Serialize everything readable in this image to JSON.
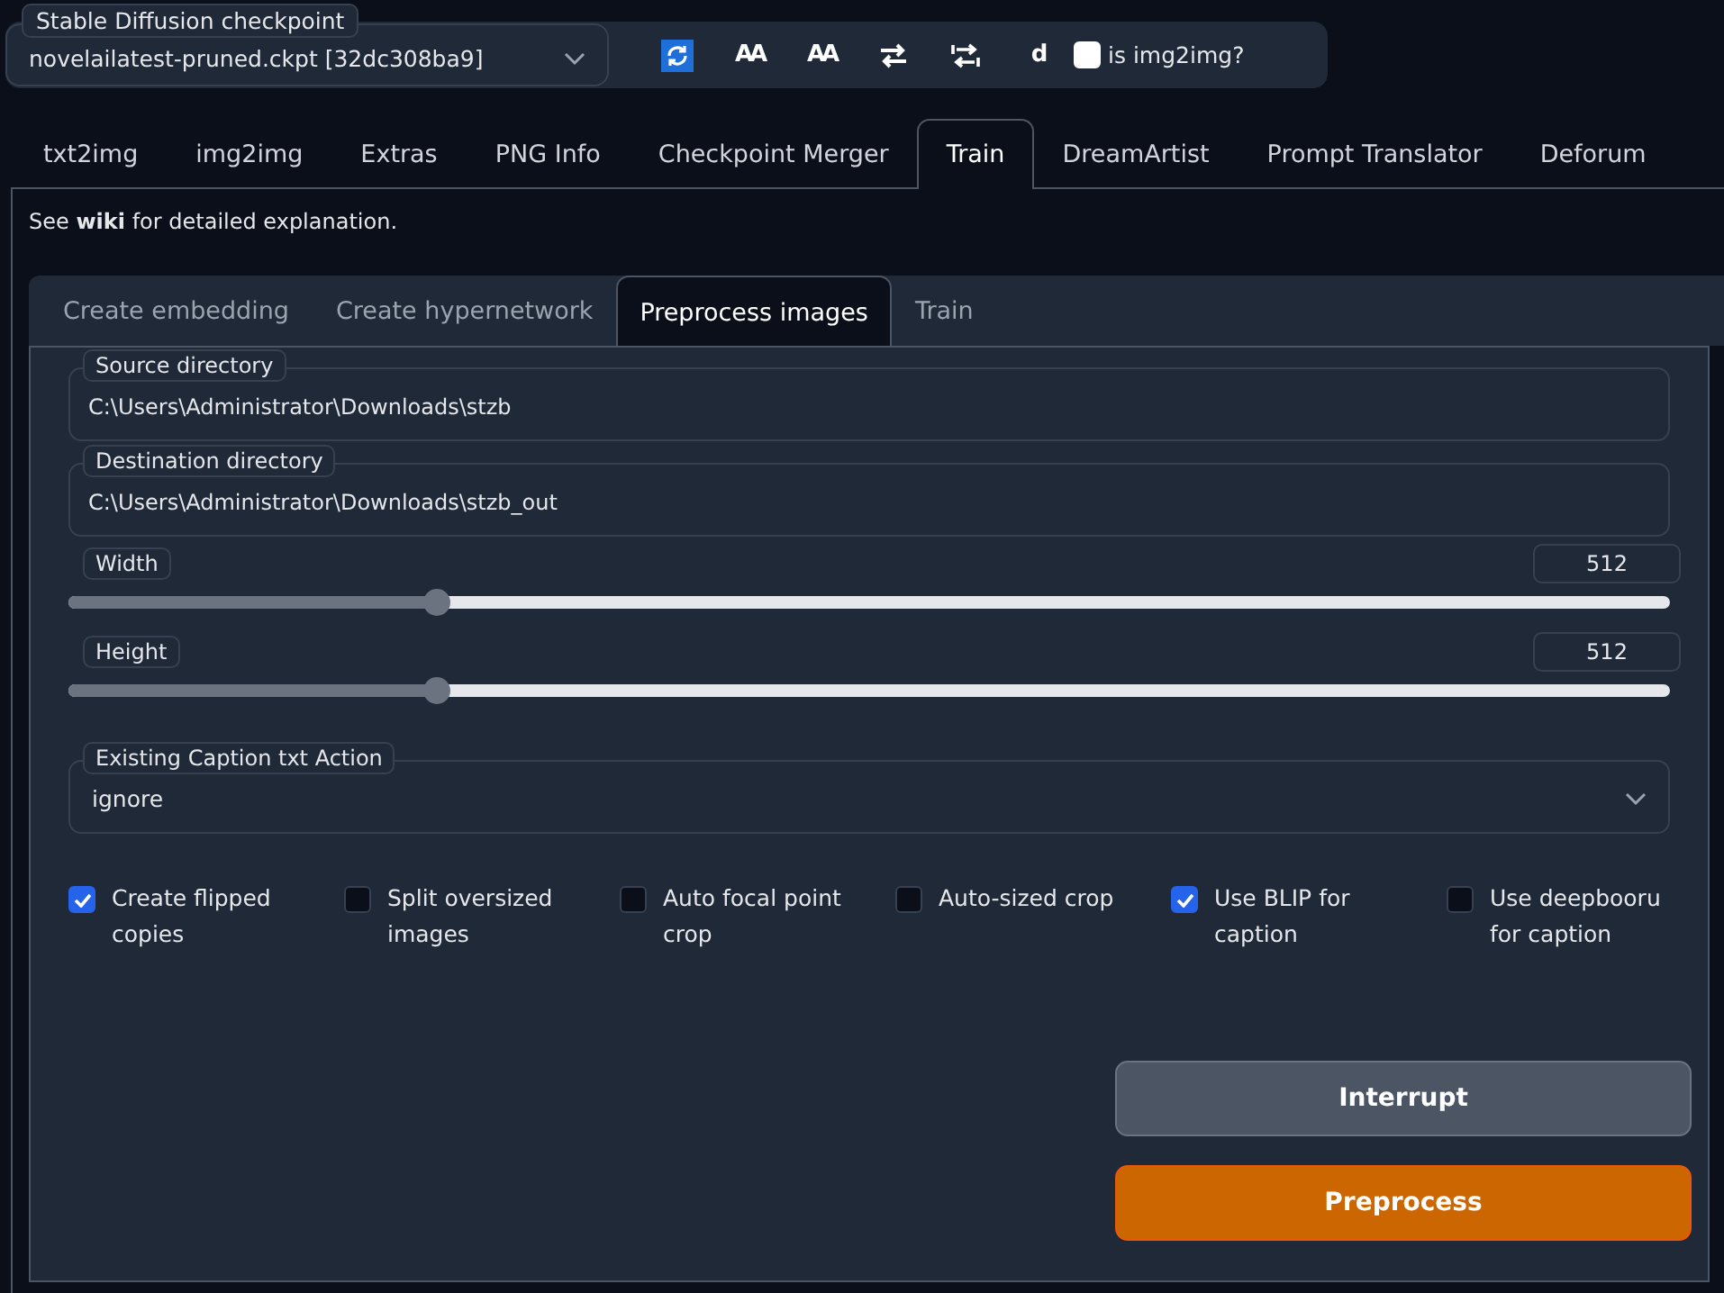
{
  "checkpoint": {
    "label": "Stable Diffusion checkpoint",
    "value": "novelailatest-pruned.ckpt [32dc308ba9]"
  },
  "toolbar": [
    {
      "kind": "refresh"
    },
    {
      "kind": "text",
      "label": "AA"
    },
    {
      "kind": "text",
      "label": "AA"
    },
    {
      "kind": "swap"
    },
    {
      "kind": "tabswap"
    },
    {
      "kind": "text",
      "label": "d"
    }
  ],
  "img2img_checkbox": {
    "label": "is img2img?",
    "checked": false
  },
  "tabs": [
    {
      "label": "txt2img",
      "selected": false
    },
    {
      "label": "img2img",
      "selected": false
    },
    {
      "label": "Extras",
      "selected": false
    },
    {
      "label": "PNG Info",
      "selected": false
    },
    {
      "label": "Checkpoint Merger",
      "selected": false
    },
    {
      "label": "Train",
      "selected": true
    },
    {
      "label": "DreamArtist",
      "selected": false
    },
    {
      "label": "Prompt Translator",
      "selected": false
    },
    {
      "label": "Deforum",
      "selected": false
    }
  ],
  "info": "See **wiki** for detailed explanation.",
  "subtabs": [
    {
      "label": "Create embedding",
      "selected": false
    },
    {
      "label": "Create hypernetwork",
      "selected": false
    },
    {
      "label": "Preprocess images",
      "selected": true
    },
    {
      "label": "Train",
      "selected": false
    }
  ],
  "fields": [
    {
      "label": "Source directory",
      "value": "C:\\Users\\Administrator\\Downloads\\stzb"
    },
    {
      "label": "Destination directory",
      "value": "C:\\Users\\Administrator\\Downloads\\stzb_out"
    }
  ],
  "sliders": [
    {
      "label": "Width",
      "value": "512",
      "level": 0.23
    },
    {
      "label": "Height",
      "value": "512",
      "level": 0.23
    }
  ],
  "caption_action": {
    "label": "Existing Caption txt Action",
    "value": "ignore"
  },
  "options": [
    {
      "label": "Create flipped copies",
      "checked": true
    },
    {
      "label": "Split oversized images",
      "checked": false
    },
    {
      "label": "Auto focal point crop",
      "checked": false
    },
    {
      "label": "Auto-sized crop",
      "checked": false
    },
    {
      "label": "Use BLIP for caption",
      "checked": true
    },
    {
      "label": "Use deepbooru for caption",
      "checked": false
    }
  ],
  "buttons": [
    {
      "label": "Interrupt",
      "kind": "secondary"
    },
    {
      "label": "Preprocess",
      "kind": "primary"
    }
  ]
}
